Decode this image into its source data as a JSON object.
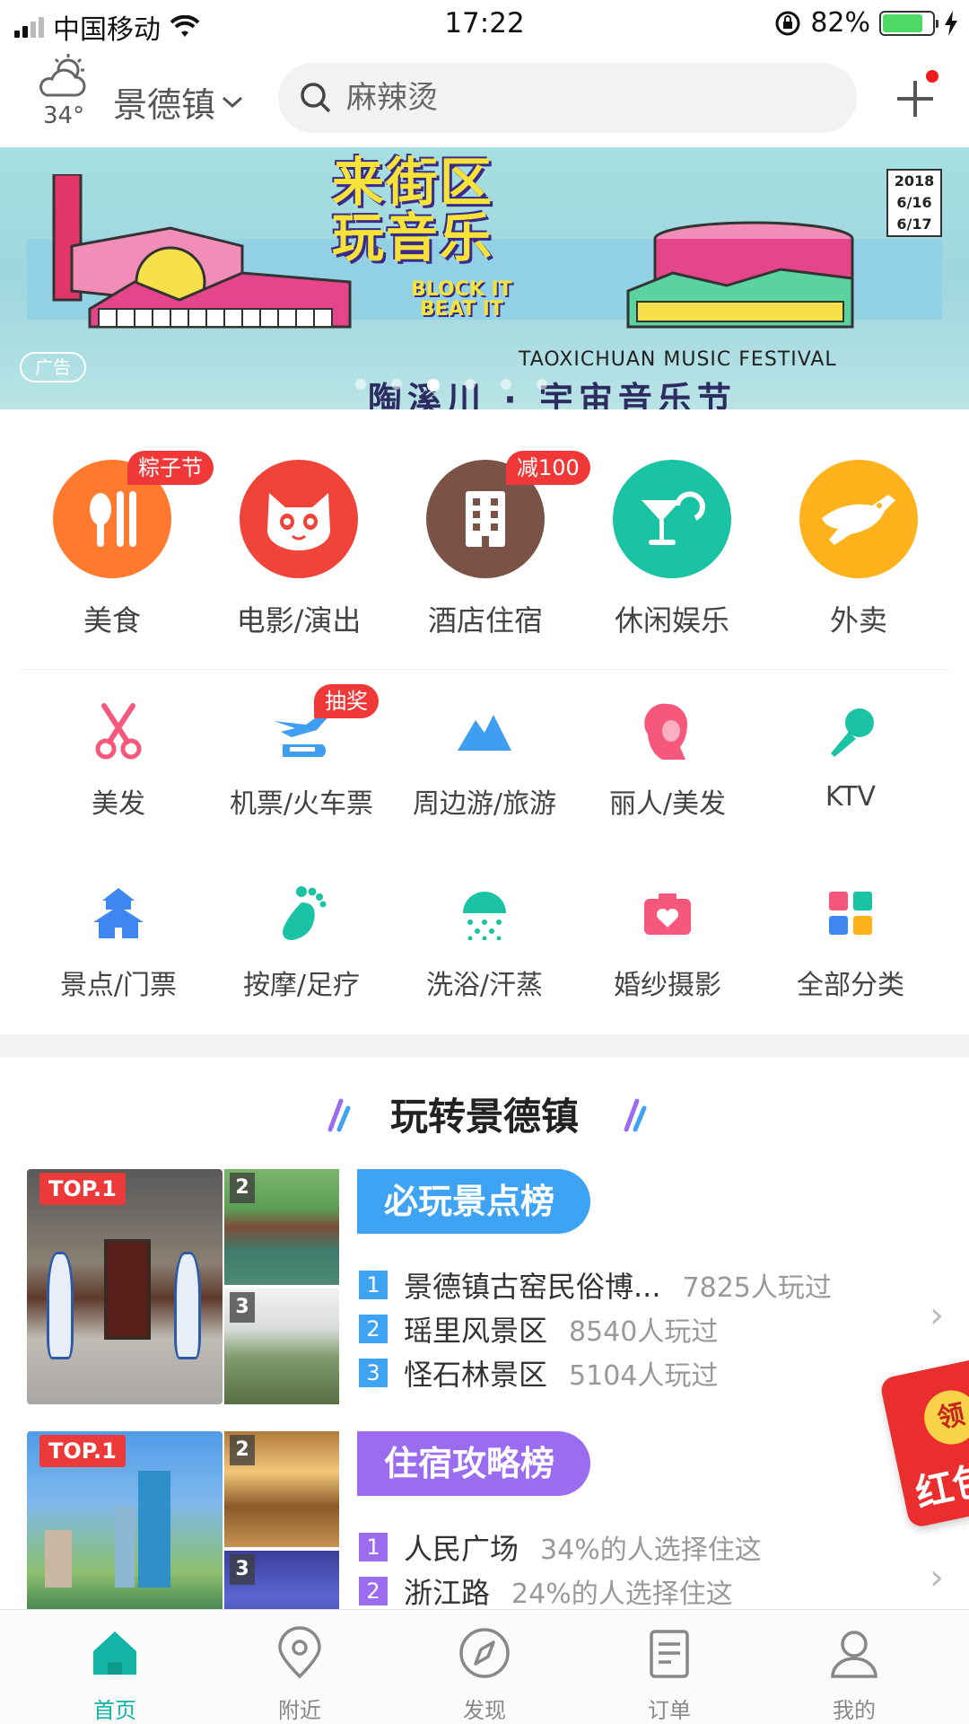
{
  "status_bar": {
    "carrier": "中国移动",
    "time": "17:22",
    "battery_percent": "82%",
    "battery_level": 0.82
  },
  "header": {
    "temperature": "34°",
    "city": "景德镇",
    "search_placeholder": "麻辣烫"
  },
  "banner": {
    "title_line1": "来街区",
    "title_line2": "玩音乐",
    "subtitle_line1": "BLOCK IT",
    "subtitle_line2": "BEAT IT",
    "date_year": "2018",
    "date_day1": "6/16",
    "date_day2": "6/17",
    "festival_en": "TAOXICHUAN MUSIC FESTIVAL",
    "festival_cn": "陶溪川 · 宇宙音乐节",
    "ad_tag": "广告",
    "slide_count": 6,
    "active_slide": 2
  },
  "primary_categories": [
    {
      "label": "美食",
      "badge": "粽子节",
      "color": "#ff7a2e",
      "icon": "fork-knife-icon"
    },
    {
      "label": "电影/演出",
      "badge": "",
      "color": "#f0443a",
      "icon": "cat-icon"
    },
    {
      "label": "酒店住宿",
      "badge": "减100",
      "color": "#7a5346",
      "icon": "building-icon"
    },
    {
      "label": "休闲娱乐",
      "badge": "",
      "color": "#19c3a3",
      "icon": "cocktail-icon"
    },
    {
      "label": "外卖",
      "badge": "",
      "color": "#ffb21c",
      "icon": "kangaroo-icon"
    }
  ],
  "secondary_categories": [
    {
      "label": "美发",
      "badge": "",
      "color": "#f5587a",
      "icon": "scissors-icon"
    },
    {
      "label": "机票/火车票",
      "badge": "抽奖",
      "color": "#3f9ef0",
      "icon": "plane-train-icon"
    },
    {
      "label": "周边游/旅游",
      "badge": "",
      "color": "#3f9ef0",
      "icon": "mountain-icon"
    },
    {
      "label": "丽人/美发",
      "badge": "",
      "color": "#f5587a",
      "icon": "woman-icon"
    },
    {
      "label": "KTV",
      "badge": "",
      "color": "#19c3a3",
      "icon": "microphone-icon"
    },
    {
      "label": "景点/门票",
      "badge": "",
      "color": "#3f86f0",
      "icon": "temple-icon"
    },
    {
      "label": "按摩/足疗",
      "badge": "",
      "color": "#19c3a3",
      "icon": "footprint-icon"
    },
    {
      "label": "洗浴/汗蒸",
      "badge": "",
      "color": "#19c3a3",
      "icon": "shower-icon"
    },
    {
      "label": "婚纱摄影",
      "badge": "",
      "color": "#f5587a",
      "icon": "camera-heart-icon"
    },
    {
      "label": "全部分类",
      "badge": "",
      "color": "#3f86f0",
      "icon": "grid-icon"
    }
  ],
  "section": {
    "title": "玩转景德镇"
  },
  "rankings": [
    {
      "top_badge": "TOP.1",
      "thumb2": "2",
      "thumb3": "3",
      "heading": "必玩景点榜",
      "heading_color": "#3fa3f3",
      "items": [
        {
          "rank": "1",
          "name": "景德镇古窑民俗博...",
          "meta": "7825人玩过"
        },
        {
          "rank": "2",
          "name": "瑶里风景区",
          "meta": "8540人玩过"
        },
        {
          "rank": "3",
          "name": "怪石林景区",
          "meta": "5104人玩过"
        }
      ]
    },
    {
      "top_badge": "TOP.1",
      "thumb2": "2",
      "thumb3": "3",
      "heading": "住宿攻略榜",
      "heading_color": "#9b6cf0",
      "items": [
        {
          "rank": "1",
          "name": "人民广场",
          "meta": "34%的人选择住这"
        },
        {
          "rank": "2",
          "name": "浙江路",
          "meta": "24%的人选择住这"
        }
      ]
    }
  ],
  "floating_redpacket": {
    "coin": "领",
    "text": "红包"
  },
  "tabbar": [
    {
      "label": "首页",
      "icon": "home-icon",
      "active": true
    },
    {
      "label": "附近",
      "icon": "location-pin-icon",
      "active": false
    },
    {
      "label": "发现",
      "icon": "compass-icon",
      "active": false
    },
    {
      "label": "订单",
      "icon": "order-list-icon",
      "active": false
    },
    {
      "label": "我的",
      "icon": "user-icon",
      "active": false
    }
  ],
  "colors": {
    "accent": "#12b5a6",
    "badge_red": "#f13838"
  }
}
